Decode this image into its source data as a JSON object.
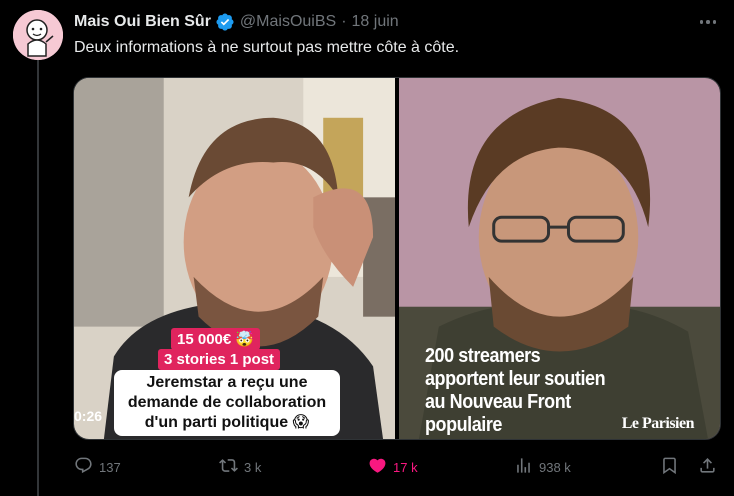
{
  "tweet": {
    "author_name": "Mais Oui Bien Sûr",
    "handle": "@MaisOuiBS",
    "separator": "·",
    "time": "18 juin",
    "text": "Deux informations à ne surtout pas mettre côte à côte.",
    "verified": true
  },
  "media": {
    "left": {
      "badge_price": "15 000€ 🤯",
      "badge_stories": "3 stories 1 post",
      "caption": "Jeremstar a reçu une\ndemande de collaboration\nd'un parti politique 😱",
      "timestamp": "0:26"
    },
    "right": {
      "headline": "200 streamers\napportent leur soutien\nau Nouveau Front\npopulaire",
      "logo": "Le Parisien"
    }
  },
  "actions": {
    "replies": "137",
    "retweets": "3 k",
    "likes": "17 k",
    "views": "938 k"
  },
  "icons": {
    "reply": "reply-icon",
    "retweet": "retweet-icon",
    "like": "heart-icon",
    "views": "views-icon",
    "bookmark": "bookmark-icon",
    "share": "share-icon",
    "more": "more-icon",
    "verified": "verified-badge-icon"
  },
  "colors": {
    "background": "#000000",
    "text_primary": "#e7e9ea",
    "text_secondary": "#71767b",
    "verified_blue": "#1d9bf0",
    "like_pink": "#f91880",
    "badge_red": "#e0245e"
  }
}
